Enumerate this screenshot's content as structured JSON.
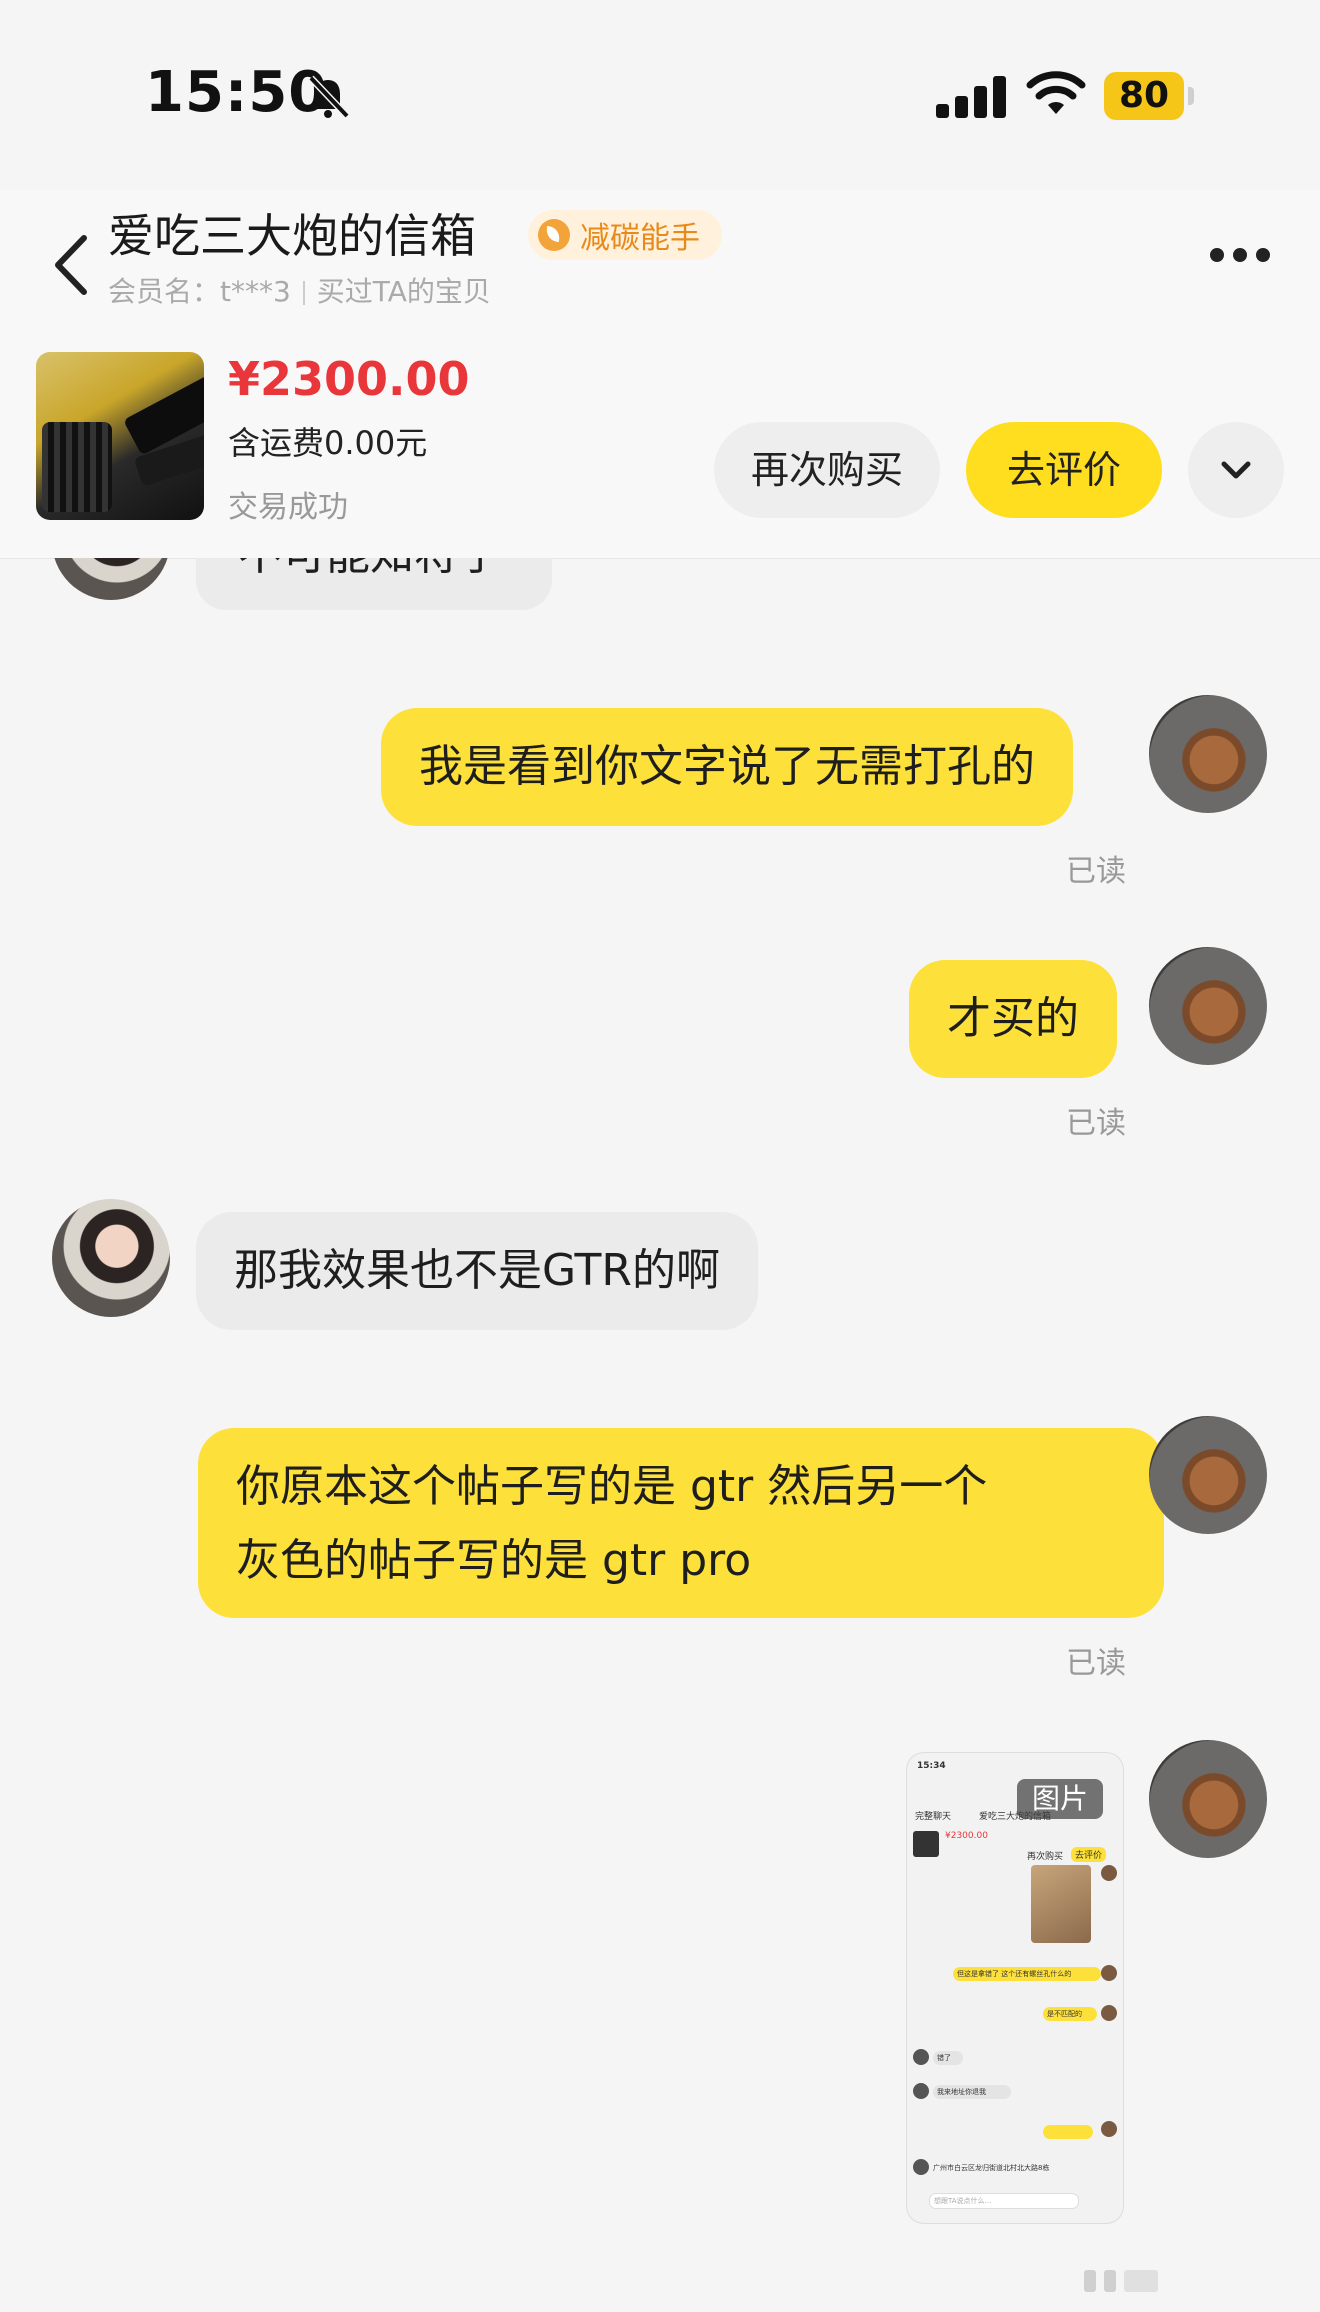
{
  "status_bar": {
    "time": "15:50",
    "battery": "80"
  },
  "header": {
    "shop_name": "爱吃三大炮的信箱",
    "badge": "减碳能手",
    "member_label": "会员名：t***3",
    "bought_label": "买过TA的宝贝"
  },
  "order": {
    "price": "¥2300.00",
    "shipping": "含运费0.00元",
    "status": "交易成功",
    "rebuy_button": "再次购买",
    "review_button": "去评价"
  },
  "messages": [
    {
      "side": "theirs",
      "text": "不可能知将子",
      "partial": true
    },
    {
      "side": "mine",
      "text": "我是看到你文字说了无需打孔的",
      "read": "已读"
    },
    {
      "side": "mine",
      "text": "才买的",
      "read": "已读"
    },
    {
      "side": "theirs",
      "text": "那我效果也不是GTR的啊"
    },
    {
      "side": "mine",
      "lines": [
        "你原本这个帖子写的是 gtr 然后另一个",
        "灰色的帖子写的是 gtr pro"
      ],
      "read": "已读"
    },
    {
      "side": "mine",
      "type": "image",
      "label": "图片"
    }
  ],
  "mini_screenshot": {
    "time": "15:34",
    "title": "爱吃三大炮的信箱",
    "back": "完整聊天",
    "price": "¥2300.00",
    "rebuy": "再次购买",
    "review": "去评价",
    "msg1": "但这是拿错了 这个还有螺丝孔什么的",
    "msg2": "是不匹配的",
    "msg3": "错了",
    "msg4": "我来地址你退我",
    "msg5": "广州市白云区龙归街道北村北大路8栋",
    "input": "想跟TA说点什么..."
  },
  "colors": {
    "accent_yellow": "#fde13a",
    "price_red": "#e8363b",
    "badge_orange": "#e88a1a"
  }
}
